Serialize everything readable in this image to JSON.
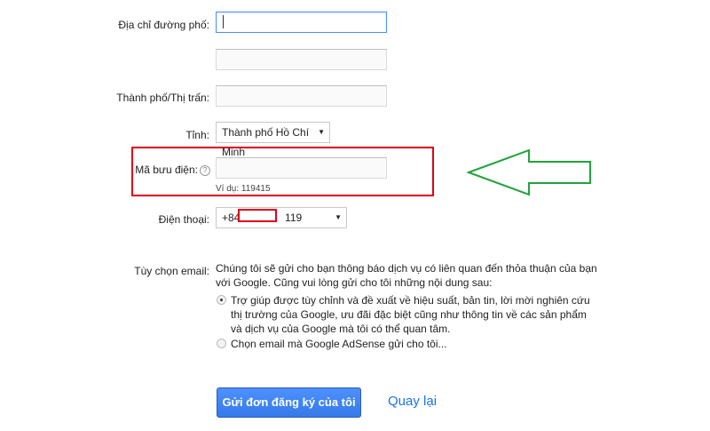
{
  "form": {
    "street_label": "Địa chỉ đường phố:",
    "street_value": "",
    "street2_value": "",
    "city_label": "Thành phố/Thị trấn:",
    "city_value": "",
    "province_label": "Tỉnh:",
    "province_selected": "Thành phố Hồ Chí Minh",
    "postal_label": "Mã bưu điện:",
    "postal_help": "?",
    "postal_value": "",
    "postal_hint": "Ví dụ: 119415",
    "phone_label": "Điện thoại:",
    "phone_prefix": "+84",
    "phone_suffix": "119",
    "email_label": "Tùy chọn email:",
    "email_intro": "Chúng tôi sẽ gửi cho bạn thông báo dịch vụ có liên quan đến thỏa thuận của bạn với Google. Cũng vui lòng gửi cho tôi những nội dung sau:",
    "option1": "Trợ giúp được tùy chỉnh và đề xuất về hiệu suất, bản tin, lời mời nghiên cứu thị trường của Google, ưu đãi đặc biệt cũng như thông tin về các sản phẩm và dịch vụ của Google mà tôi có thể quan tâm.",
    "option2": "Chọn email mà Google AdSense gửi cho tôi...",
    "submit_label": "Gửi đơn đăng ký của tôi",
    "back_label": "Quay lại"
  },
  "colors": {
    "annotation_red": "#e0001b",
    "arrow_green": "#21a33a",
    "primary_blue": "#4d90fe",
    "link_blue": "#1a73e8"
  }
}
